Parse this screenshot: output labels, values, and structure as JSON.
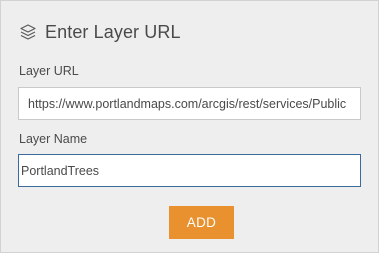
{
  "dialog": {
    "title": "Enter Layer URL",
    "header_icon": "layers-icon"
  },
  "url_field": {
    "label": "Layer URL",
    "value": "https://www.portlandmaps.com/arcgis/rest/services/Public"
  },
  "name_field": {
    "label": "Layer Name",
    "value": "PortlandTrees"
  },
  "add_button": {
    "label": "ADD",
    "color": "#e8912e"
  }
}
